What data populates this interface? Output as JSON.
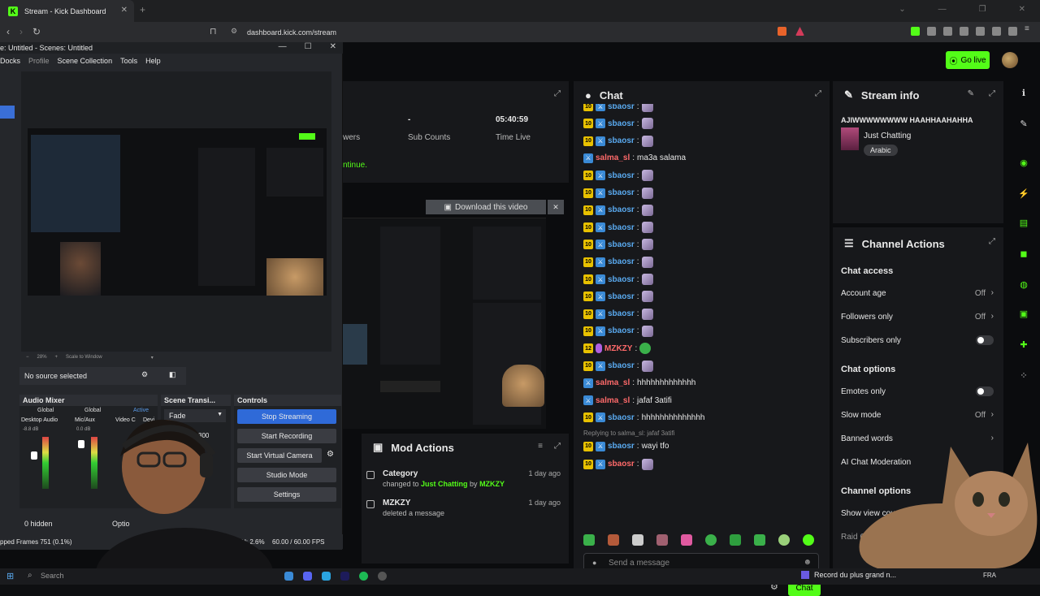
{
  "browser": {
    "tab_title": "Stream - Kick Dashboard",
    "favicon_letter": "K",
    "url": "dashboard.kick.com/stream"
  },
  "kick": {
    "go_live_label": "Go live",
    "stats": {
      "viewers_label": "wers",
      "sub_value": "-",
      "sub_label": "Sub Counts",
      "time_value": "05:40:59",
      "time_label": "Time Live",
      "continue_text": "ntinue."
    },
    "download_label": "Download this video",
    "chat": {
      "title": "Chat",
      "messages": [
        {
          "user": "sbaosr",
          "text": "",
          "badge": "10",
          "ucolor": "blue",
          "emote": true
        },
        {
          "user": "sbaosr",
          "text": "",
          "badge": "10",
          "ucolor": "blue",
          "emote": true
        },
        {
          "user": "sbaosr",
          "text": "",
          "badge": "10",
          "ucolor": "blue",
          "emote": true
        },
        {
          "user": "salma_sl",
          "text": "ma3a salama",
          "badge": "",
          "ucolor": "red",
          "emote": false
        },
        {
          "user": "sbaosr",
          "text": "",
          "badge": "10",
          "ucolor": "blue",
          "emote": true
        },
        {
          "user": "sbaosr",
          "text": "",
          "badge": "10",
          "ucolor": "blue",
          "emote": true
        },
        {
          "user": "sbaosr",
          "text": "",
          "badge": "10",
          "ucolor": "blue",
          "emote": true
        },
        {
          "user": "sbaosr",
          "text": "",
          "badge": "10",
          "ucolor": "blue",
          "emote": true
        },
        {
          "user": "sbaosr",
          "text": "",
          "badge": "10",
          "ucolor": "blue",
          "emote": true
        },
        {
          "user": "sbaosr",
          "text": "",
          "badge": "10",
          "ucolor": "blue",
          "emote": true
        },
        {
          "user": "sbaosr",
          "text": "",
          "badge": "10",
          "ucolor": "blue",
          "emote": true
        },
        {
          "user": "sbaosr",
          "text": "",
          "badge": "10",
          "ucolor": "blue",
          "emote": true
        },
        {
          "user": "sbaosr",
          "text": "",
          "badge": "10",
          "ucolor": "blue",
          "emote": true
        },
        {
          "user": "sbaosr",
          "text": "",
          "badge": "10",
          "ucolor": "blue",
          "emote": true
        },
        {
          "user": "MZKZY",
          "text": "",
          "badge": "12",
          "ucolor": "pink",
          "emote": true
        },
        {
          "user": "sbaosr",
          "text": "",
          "badge": "10",
          "ucolor": "blue",
          "emote": true
        },
        {
          "user": "salma_sl",
          "text": "hhhhhhhhhhhhh",
          "badge": "",
          "ucolor": "red",
          "emote": false
        },
        {
          "user": "salma_sl",
          "text": "jafaf 3atifi",
          "badge": "",
          "ucolor": "red",
          "emote": false
        },
        {
          "user": "sbaosr",
          "text": "hhhhhhhhhhhhhh",
          "badge": "10",
          "ucolor": "blue",
          "emote": false
        }
      ],
      "reply_hint": "Replying to salma_sl: jafaf 3atifi",
      "reply_msg": {
        "user": "sbaosr",
        "text": "wayi tfo",
        "badge": "10"
      },
      "last_msg": {
        "user": "sbaosr",
        "badge": "10"
      },
      "input_placeholder": "Send a message",
      "send_label": "Chat"
    },
    "mod_actions": {
      "title": "Mod Actions",
      "rows": [
        {
          "title": "Category",
          "pre": "changed to ",
          "highlight": "Just Chatting",
          "mid": " by ",
          "by": "MZKZY",
          "date": "1 day ago"
        },
        {
          "title": "MZKZY",
          "pre": "deleted a message",
          "highlight": "",
          "mid": "",
          "by": "",
          "date": "1 day ago"
        }
      ]
    },
    "stream_info": {
      "title": "Stream info",
      "stream_title": "AJIWWWWWWWW HAAHHAAHAHHA",
      "category": "Just Chatting",
      "tag": "Arabic"
    },
    "channel_actions": {
      "title": "Channel Actions",
      "chat_access": "Chat access",
      "account_age": "Account age",
      "account_age_val": "Off",
      "followers_only": "Followers only",
      "followers_only_val": "Off",
      "subscribers_only": "Subscribers only",
      "chat_options": "Chat options",
      "emotes_only": "Emotes only",
      "slow_mode": "Slow mode",
      "slow_mode_val": "Off",
      "banned_words": "Banned words",
      "ai_moderation": "AI Chat Moderation",
      "channel_options": "Channel options",
      "show_view_count": "Show view count",
      "raid_channel": "Raid Chan"
    }
  },
  "obs": {
    "title": "e: Untitled - Scenes: Untitled",
    "menu": [
      "Docks",
      "Profile",
      "Scene Collection",
      "Tools",
      "Help"
    ],
    "zoom": "28%",
    "scale_label": "Scale to Window",
    "no_source": "No source selected",
    "audio_mixer": "Audio Mixer",
    "mixer_cols": [
      "Global",
      "Global",
      "Active"
    ],
    "mixer_tracks": [
      "Desktop Audio",
      "Mic/Aux",
      "Video C",
      "Devi"
    ],
    "mixer_db": [
      "-8.8 dB",
      "0.0 dB"
    ],
    "scene_transitions": "Scene Transi...",
    "transition": "Fade",
    "duration_label": "on",
    "duration_val": "300",
    "controls": "Controls",
    "stop_streaming": "Stop Streaming",
    "start_recording": "Start Recording",
    "start_virtual_camera": "Start Virtual Camera",
    "studio_mode": "Studio Mode",
    "settings": "Settings",
    "hidden": "0 hidden",
    "options": "Optio",
    "dropped": "pped Frames 751 (0.1%)",
    "cpu": "CPU: 2.6%",
    "fps": "60.00 / 60.00 FPS"
  },
  "taskbar": {
    "search": "Search",
    "media": "Record du plus grand n...",
    "lang": "FRA"
  }
}
